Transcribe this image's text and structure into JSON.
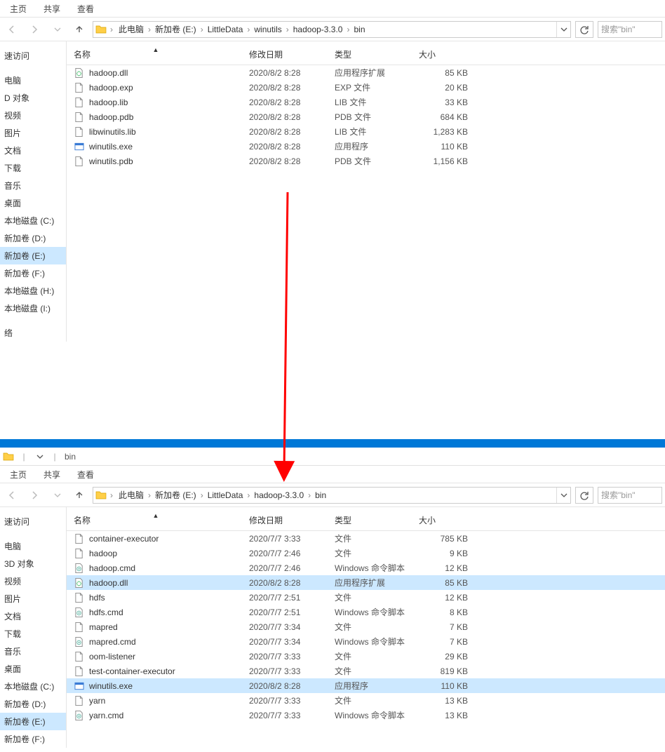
{
  "top": {
    "ribbon_tabs": [
      "主页",
      "共享",
      "查看"
    ],
    "breadcrumbs": [
      "此电脑",
      "新加卷 (E:)",
      "LittleData",
      "winutils",
      "hadoop-3.3.0",
      "bin"
    ],
    "search_placeholder": "搜索\"bin\"",
    "sidebar": [
      {
        "label": "速访问",
        "selected": false
      },
      {
        "label": "",
        "spacer": true
      },
      {
        "label": "电脑",
        "selected": false
      },
      {
        "label": "D 对象",
        "selected": false
      },
      {
        "label": "视频",
        "selected": false
      },
      {
        "label": "图片",
        "selected": false
      },
      {
        "label": "文档",
        "selected": false
      },
      {
        "label": "下载",
        "selected": false
      },
      {
        "label": "音乐",
        "selected": false
      },
      {
        "label": "桌面",
        "selected": false
      },
      {
        "label": "本地磁盘 (C:)",
        "selected": false
      },
      {
        "label": "新加卷 (D:)",
        "selected": false
      },
      {
        "label": "新加卷 (E:)",
        "selected": true
      },
      {
        "label": "新加卷 (F:)",
        "selected": false
      },
      {
        "label": "本地磁盘 (H:)",
        "selected": false
      },
      {
        "label": "本地磁盘 (I:)",
        "selected": false
      },
      {
        "label": "",
        "spacer": true
      },
      {
        "label": "络",
        "selected": false
      }
    ],
    "columns": {
      "name": "名称",
      "date": "修改日期",
      "type": "类型",
      "size": "大小"
    },
    "files": [
      {
        "icon": "gear",
        "name": "hadoop.dll",
        "date": "2020/8/2 8:28",
        "type": "应用程序扩展",
        "size": "85 KB",
        "selected": false
      },
      {
        "icon": "doc",
        "name": "hadoop.exp",
        "date": "2020/8/2 8:28",
        "type": "EXP 文件",
        "size": "20 KB",
        "selected": false
      },
      {
        "icon": "doc",
        "name": "hadoop.lib",
        "date": "2020/8/2 8:28",
        "type": "LIB 文件",
        "size": "33 KB",
        "selected": false
      },
      {
        "icon": "doc",
        "name": "hadoop.pdb",
        "date": "2020/8/2 8:28",
        "type": "PDB 文件",
        "size": "684 KB",
        "selected": false
      },
      {
        "icon": "doc",
        "name": "libwinutils.lib",
        "date": "2020/8/2 8:28",
        "type": "LIB 文件",
        "size": "1,283 KB",
        "selected": false
      },
      {
        "icon": "exe",
        "name": "winutils.exe",
        "date": "2020/8/2 8:28",
        "type": "应用程序",
        "size": "110 KB",
        "selected": false
      },
      {
        "icon": "doc",
        "name": "winutils.pdb",
        "date": "2020/8/2 8:28",
        "type": "PDB 文件",
        "size": "1,156 KB",
        "selected": false
      }
    ]
  },
  "bottom": {
    "title_caption": "bin",
    "ribbon_tabs": [
      "主页",
      "共享",
      "查看"
    ],
    "breadcrumbs": [
      "此电脑",
      "新加卷 (E:)",
      "LittleData",
      "hadoop-3.3.0",
      "bin"
    ],
    "search_placeholder": "搜索\"bin\"",
    "sidebar": [
      {
        "label": "速访问",
        "selected": false
      },
      {
        "label": "",
        "spacer": true
      },
      {
        "label": "电脑",
        "selected": false
      },
      {
        "label": "3D 对象",
        "selected": false
      },
      {
        "label": "视频",
        "selected": false
      },
      {
        "label": "图片",
        "selected": false
      },
      {
        "label": "文档",
        "selected": false
      },
      {
        "label": "下载",
        "selected": false
      },
      {
        "label": "音乐",
        "selected": false
      },
      {
        "label": "桌面",
        "selected": false
      },
      {
        "label": "本地磁盘 (C:)",
        "selected": false
      },
      {
        "label": "新加卷 (D:)",
        "selected": false
      },
      {
        "label": "新加卷 (E:)",
        "selected": true
      },
      {
        "label": "新加卷 (F:)",
        "selected": false
      }
    ],
    "columns": {
      "name": "名称",
      "date": "修改日期",
      "type": "类型",
      "size": "大小"
    },
    "files": [
      {
        "icon": "doc",
        "name": "container-executor",
        "date": "2020/7/7 3:33",
        "type": "文件",
        "size": "785 KB",
        "selected": false
      },
      {
        "icon": "doc",
        "name": "hadoop",
        "date": "2020/7/7 2:46",
        "type": "文件",
        "size": "9 KB",
        "selected": false
      },
      {
        "icon": "cmd",
        "name": "hadoop.cmd",
        "date": "2020/7/7 2:46",
        "type": "Windows 命令脚本",
        "size": "12 KB",
        "selected": false
      },
      {
        "icon": "gear",
        "name": "hadoop.dll",
        "date": "2020/8/2 8:28",
        "type": "应用程序扩展",
        "size": "85 KB",
        "selected": true
      },
      {
        "icon": "doc",
        "name": "hdfs",
        "date": "2020/7/7 2:51",
        "type": "文件",
        "size": "12 KB",
        "selected": false
      },
      {
        "icon": "cmd",
        "name": "hdfs.cmd",
        "date": "2020/7/7 2:51",
        "type": "Windows 命令脚本",
        "size": "8 KB",
        "selected": false
      },
      {
        "icon": "doc",
        "name": "mapred",
        "date": "2020/7/7 3:34",
        "type": "文件",
        "size": "7 KB",
        "selected": false
      },
      {
        "icon": "cmd",
        "name": "mapred.cmd",
        "date": "2020/7/7 3:34",
        "type": "Windows 命令脚本",
        "size": "7 KB",
        "selected": false
      },
      {
        "icon": "doc",
        "name": "oom-listener",
        "date": "2020/7/7 3:33",
        "type": "文件",
        "size": "29 KB",
        "selected": false
      },
      {
        "icon": "doc",
        "name": "test-container-executor",
        "date": "2020/7/7 3:33",
        "type": "文件",
        "size": "819 KB",
        "selected": false
      },
      {
        "icon": "exe",
        "name": "winutils.exe",
        "date": "2020/8/2 8:28",
        "type": "应用程序",
        "size": "110 KB",
        "selected": true
      },
      {
        "icon": "doc",
        "name": "yarn",
        "date": "2020/7/7 3:33",
        "type": "文件",
        "size": "13 KB",
        "selected": false
      },
      {
        "icon": "cmd",
        "name": "yarn.cmd",
        "date": "2020/7/7 3:33",
        "type": "Windows 命令脚本",
        "size": "13 KB",
        "selected": false
      }
    ]
  },
  "icons": {
    "folder": "folder-icon",
    "doc": "file-icon",
    "gear": "dll-icon",
    "exe": "exe-icon",
    "cmd": "cmd-icon"
  }
}
